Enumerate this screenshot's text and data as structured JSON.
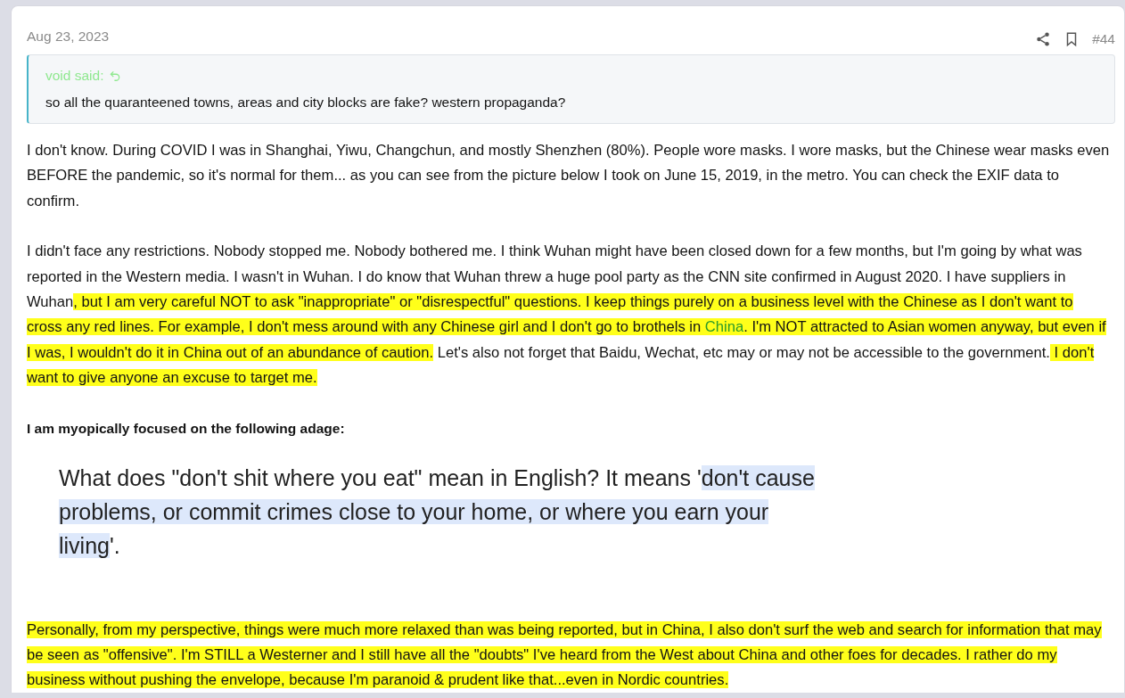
{
  "post": {
    "date": "Aug 23, 2023",
    "number": "#44"
  },
  "quote": {
    "author": "void said:",
    "text": "so all the quaranteened towns, areas and city blocks are fake? western propaganda?"
  },
  "paragraphs": [
    {
      "kind": "text",
      "segments": [
        {
          "text": "I don't know. During COVID I was in Shanghai, Yiwu, Changchun, and mostly Shenzhen (80%). People wore masks. I wore masks, but the Chinese wear masks even BEFORE the pandemic, so it's normal for them... as you can see from the picture below I took on June 15, 2019, in the metro. You can check the EXIF data to confirm.",
          "highlighted": false
        }
      ]
    },
    {
      "kind": "text",
      "segments": [
        {
          "text": "I didn't face any restrictions. Nobody stopped me. Nobody bothered me. I think Wuhan might have been closed down for a few months, but I'm going by what was reported in the Western media. I wasn't in Wuhan. I do know that Wuhan threw a huge pool party as the CNN site confirmed in August 2020. I have suppliers in Wuhan",
          "highlighted": false
        },
        {
          "text": ", but I am very careful NOT to ask \"inappropriate\" or \"disrespectful\" questions. I keep things purely on a business level with the Chinese as I don't want to cross any red lines. For example, I don't mess around with any Chinese girl and I don't go to brothels in ",
          "highlighted": true
        },
        {
          "text": "China",
          "highlighted": true,
          "link": true
        },
        {
          "text": ". I'm NOT attracted to Asian women anyway, but even if I was, I wouldn't do it in China out of an abundance of caution.",
          "highlighted": true
        },
        {
          "text": " Let's also not forget that Baidu, Wechat, etc may or may not be accessible to the government.",
          "highlighted": false
        },
        {
          "text": " I don't want to give anyone an excuse to target me.",
          "highlighted": true
        }
      ]
    },
    {
      "kind": "bold",
      "segments": [
        {
          "text": "I am myopically focused on the following adage:",
          "highlighted": false
        }
      ]
    },
    {
      "kind": "image",
      "segments": [
        {
          "text": "What does \"don't shit where you eat\" mean in English? It means '",
          "highlighted": false
        },
        {
          "text": "don't cause problems, or commit crimes close to your home, or where you earn your living",
          "highlighted": true
        },
        {
          "text": "'.",
          "highlighted": false
        }
      ]
    },
    {
      "kind": "text",
      "segments": [
        {
          "text": "Personally, from my perspective, things were much more relaxed than was being reported, but in China, I also don't surf the web and search for information that may be seen as \"offensive\". I'm STILL a Westerner and I still have all the \"doubts\" I've heard from the West about China and other foes for decades. I rather do my business without pushing the envelope, because I'm paranoid & prudent like that...even in Nordic countries.",
          "highlighted": true
        }
      ]
    }
  ]
}
